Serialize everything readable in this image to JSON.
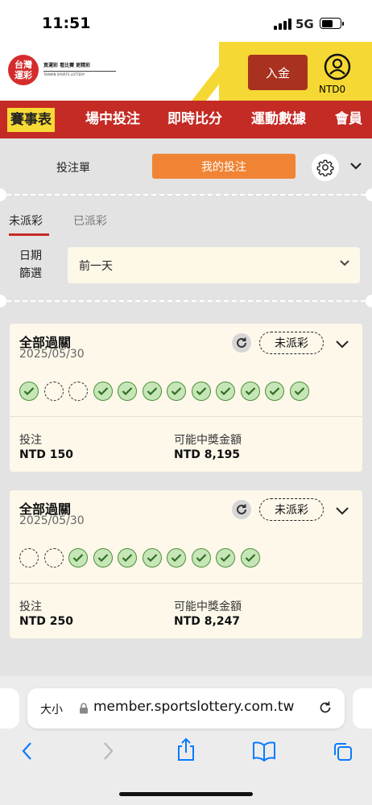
{
  "status_bar": {
    "time": "11:51",
    "network": "5G"
  },
  "header": {
    "logo_badge_line1": "台灣",
    "logo_badge_line2": "運彩",
    "logo_tagline": "買運彩 看比賽 更精彩",
    "logo_english": "TAIWAN SPORTS LOTTERY",
    "deposit_label": "入金",
    "balance": "NTD0"
  },
  "nav": {
    "items": [
      {
        "label": "賽事表",
        "active": true
      },
      {
        "label": "場中投注"
      },
      {
        "label": "即時比分"
      },
      {
        "label": "運動數據"
      },
      {
        "label": "會員"
      }
    ]
  },
  "panel": {
    "tab_betslip": "投注單",
    "tab_mybets": "我的投注",
    "subtab_unsettled": "未派彩",
    "subtab_settled": "已派彩",
    "date_filter_label": "日期篩選",
    "date_filter_value": "前一天"
  },
  "bets": [
    {
      "type": "全部過關",
      "date": "2025/05/30",
      "status": "未派彩",
      "legs": [
        "won",
        "pending",
        "pending",
        "won",
        "won",
        "won",
        "won",
        "won",
        "won",
        "won",
        "won",
        "won"
      ],
      "stake_label": "投注",
      "stake": "NTD 150",
      "payout_label": "可能中獎金額",
      "payout": "NTD 8,195"
    },
    {
      "type": "全部過關",
      "date": "2025/05/30",
      "status": "未派彩",
      "legs": [
        "pending",
        "pending",
        "won",
        "won",
        "won",
        "won",
        "won",
        "won",
        "won",
        "won"
      ],
      "stake_label": "投注",
      "stake": "NTD 250",
      "payout_label": "可能中獎金額",
      "payout": "NTD 8,247"
    }
  ],
  "browser": {
    "text_size": "大小",
    "url": "member.sportslottery.com.tw"
  },
  "colors": {
    "brand_red": "#c42b25",
    "accent_yellow": "#f7da36",
    "accent_orange": "#f08434",
    "won_green": "#4a8f38",
    "card_bg": "#fdf8ea",
    "ios_blue": "#0a7aff"
  }
}
